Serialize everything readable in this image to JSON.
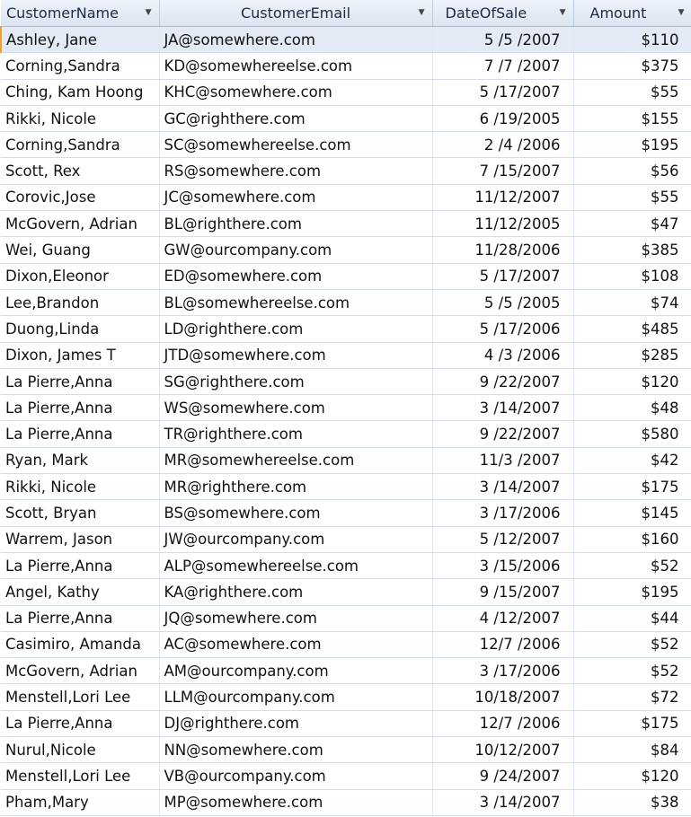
{
  "columns": [
    "CustomerName",
    "CustomerEmail",
    "DateOfSale",
    "Amount"
  ],
  "selected_row": 0,
  "rows": [
    [
      "Ashley, Jane",
      "JA@somewhere.com",
      "5 /5 /2007",
      "$110"
    ],
    [
      "Corning,Sandra",
      "KD@somewhereelse.com",
      "7 /7 /2007",
      "$375"
    ],
    [
      "Ching, Kam Hoong",
      "KHC@somewhere.com",
      "5 /17/2007",
      "$55"
    ],
    [
      "Rikki, Nicole",
      "GC@righthere.com",
      "6 /19/2005",
      "$155"
    ],
    [
      "Corning,Sandra",
      "SC@somewhereelse.com",
      "2 /4 /2006",
      "$195"
    ],
    [
      "Scott, Rex",
      "RS@somewhere.com",
      "7 /15/2007",
      "$56"
    ],
    [
      "Corovic,Jose",
      "JC@somewhere.com",
      "11/12/2007",
      "$55"
    ],
    [
      "McGovern, Adrian",
      "BL@righthere.com",
      "11/12/2005",
      "$47"
    ],
    [
      "Wei, Guang",
      "GW@ourcompany.com",
      "11/28/2006",
      "$385"
    ],
    [
      "Dixon,Eleonor",
      "ED@somewhere.com",
      "5 /17/2007",
      "$108"
    ],
    [
      "Lee,Brandon",
      "BL@somewhereelse.com",
      "5 /5 /2005",
      "$74"
    ],
    [
      "Duong,Linda",
      "LD@righthere.com",
      "5 /17/2006",
      "$485"
    ],
    [
      "Dixon, James T",
      "JTD@somewhere.com",
      "4 /3 /2006",
      "$285"
    ],
    [
      "La Pierre,Anna",
      "SG@righthere.com",
      "9 /22/2007",
      "$120"
    ],
    [
      "La Pierre,Anna",
      "WS@somewhere.com",
      "3 /14/2007",
      "$48"
    ],
    [
      "La Pierre,Anna",
      "TR@righthere.com",
      "9 /22/2007",
      "$580"
    ],
    [
      "Ryan, Mark",
      "MR@somewhereelse.com",
      "11/3 /2007",
      "$42"
    ],
    [
      "Rikki, Nicole",
      "MR@righthere.com",
      "3 /14/2007",
      "$175"
    ],
    [
      "Scott, Bryan",
      "BS@somewhere.com",
      "3 /17/2006",
      "$145"
    ],
    [
      "Warrem, Jason",
      "JW@ourcompany.com",
      "5 /12/2007",
      "$160"
    ],
    [
      "La Pierre,Anna",
      "ALP@somewhereelse.com",
      "3 /15/2006",
      "$52"
    ],
    [
      "Angel, Kathy",
      "KA@righthere.com",
      "9 /15/2007",
      "$195"
    ],
    [
      "La Pierre,Anna",
      "JQ@somewhere.com",
      "4 /12/2007",
      "$44"
    ],
    [
      "Casimiro, Amanda",
      "AC@somewhere.com",
      "12/7 /2006",
      "$52"
    ],
    [
      "McGovern, Adrian",
      "AM@ourcompany.com",
      "3 /17/2006",
      "$52"
    ],
    [
      "Menstell,Lori Lee",
      "LLM@ourcompany.com",
      "10/18/2007",
      "$72"
    ],
    [
      "La Pierre,Anna",
      "DJ@righthere.com",
      "12/7 /2006",
      "$175"
    ],
    [
      "Nurul,Nicole",
      "NN@somewhere.com",
      "10/12/2007",
      "$84"
    ],
    [
      "Menstell,Lori Lee",
      "VB@ourcompany.com",
      "9 /24/2007",
      "$120"
    ],
    [
      "Pham,Mary",
      "MP@somewhere.com",
      "3 /14/2007",
      "$38"
    ]
  ]
}
